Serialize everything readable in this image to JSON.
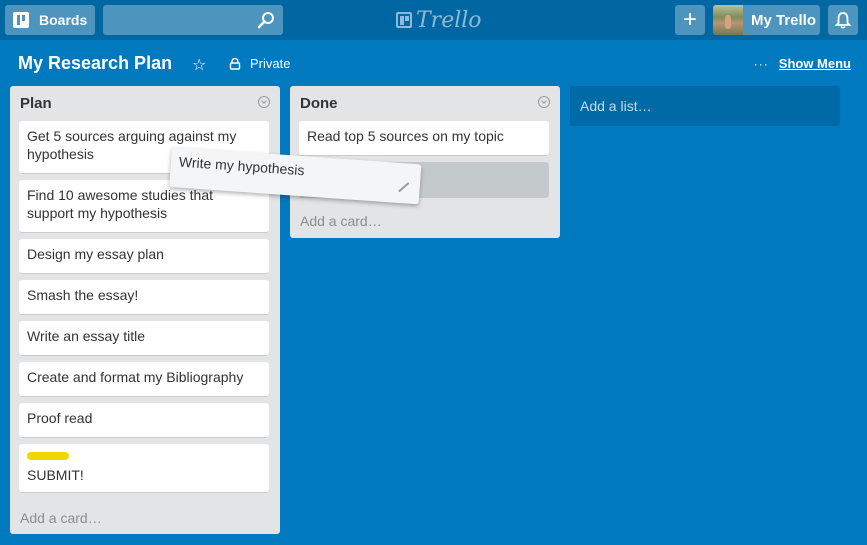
{
  "header": {
    "boards_label": "Boards",
    "search_placeholder": "",
    "logo_text": "Trello",
    "add_label": "+",
    "member_name": "My Trello"
  },
  "board": {
    "title": "My Research Plan",
    "privacy": "Private",
    "menu_dots": "···",
    "show_menu_label": "Show Menu"
  },
  "lists": [
    {
      "title": "Plan",
      "cards": [
        {
          "text": "Get 5 sources arguing against my hypothesis"
        },
        {
          "text": "Find 10 awesome studies that support my hypothesis"
        },
        {
          "text": "Design my essay plan"
        },
        {
          "text": "Smash the essay!"
        },
        {
          "text": "Write an essay title"
        },
        {
          "text": "Create and format my Bibliography"
        },
        {
          "text": "Proof read"
        },
        {
          "text": "SUBMIT!",
          "label_color": "#f2d600"
        }
      ],
      "add_card_label": "Add a card…"
    },
    {
      "title": "Done",
      "cards": [
        {
          "text": "Read top 5 sources on my topic"
        }
      ],
      "add_card_label": "Add a card…"
    }
  ],
  "add_list_label": "Add a list…",
  "dragging_card": {
    "text": "Write my hypothesis"
  }
}
